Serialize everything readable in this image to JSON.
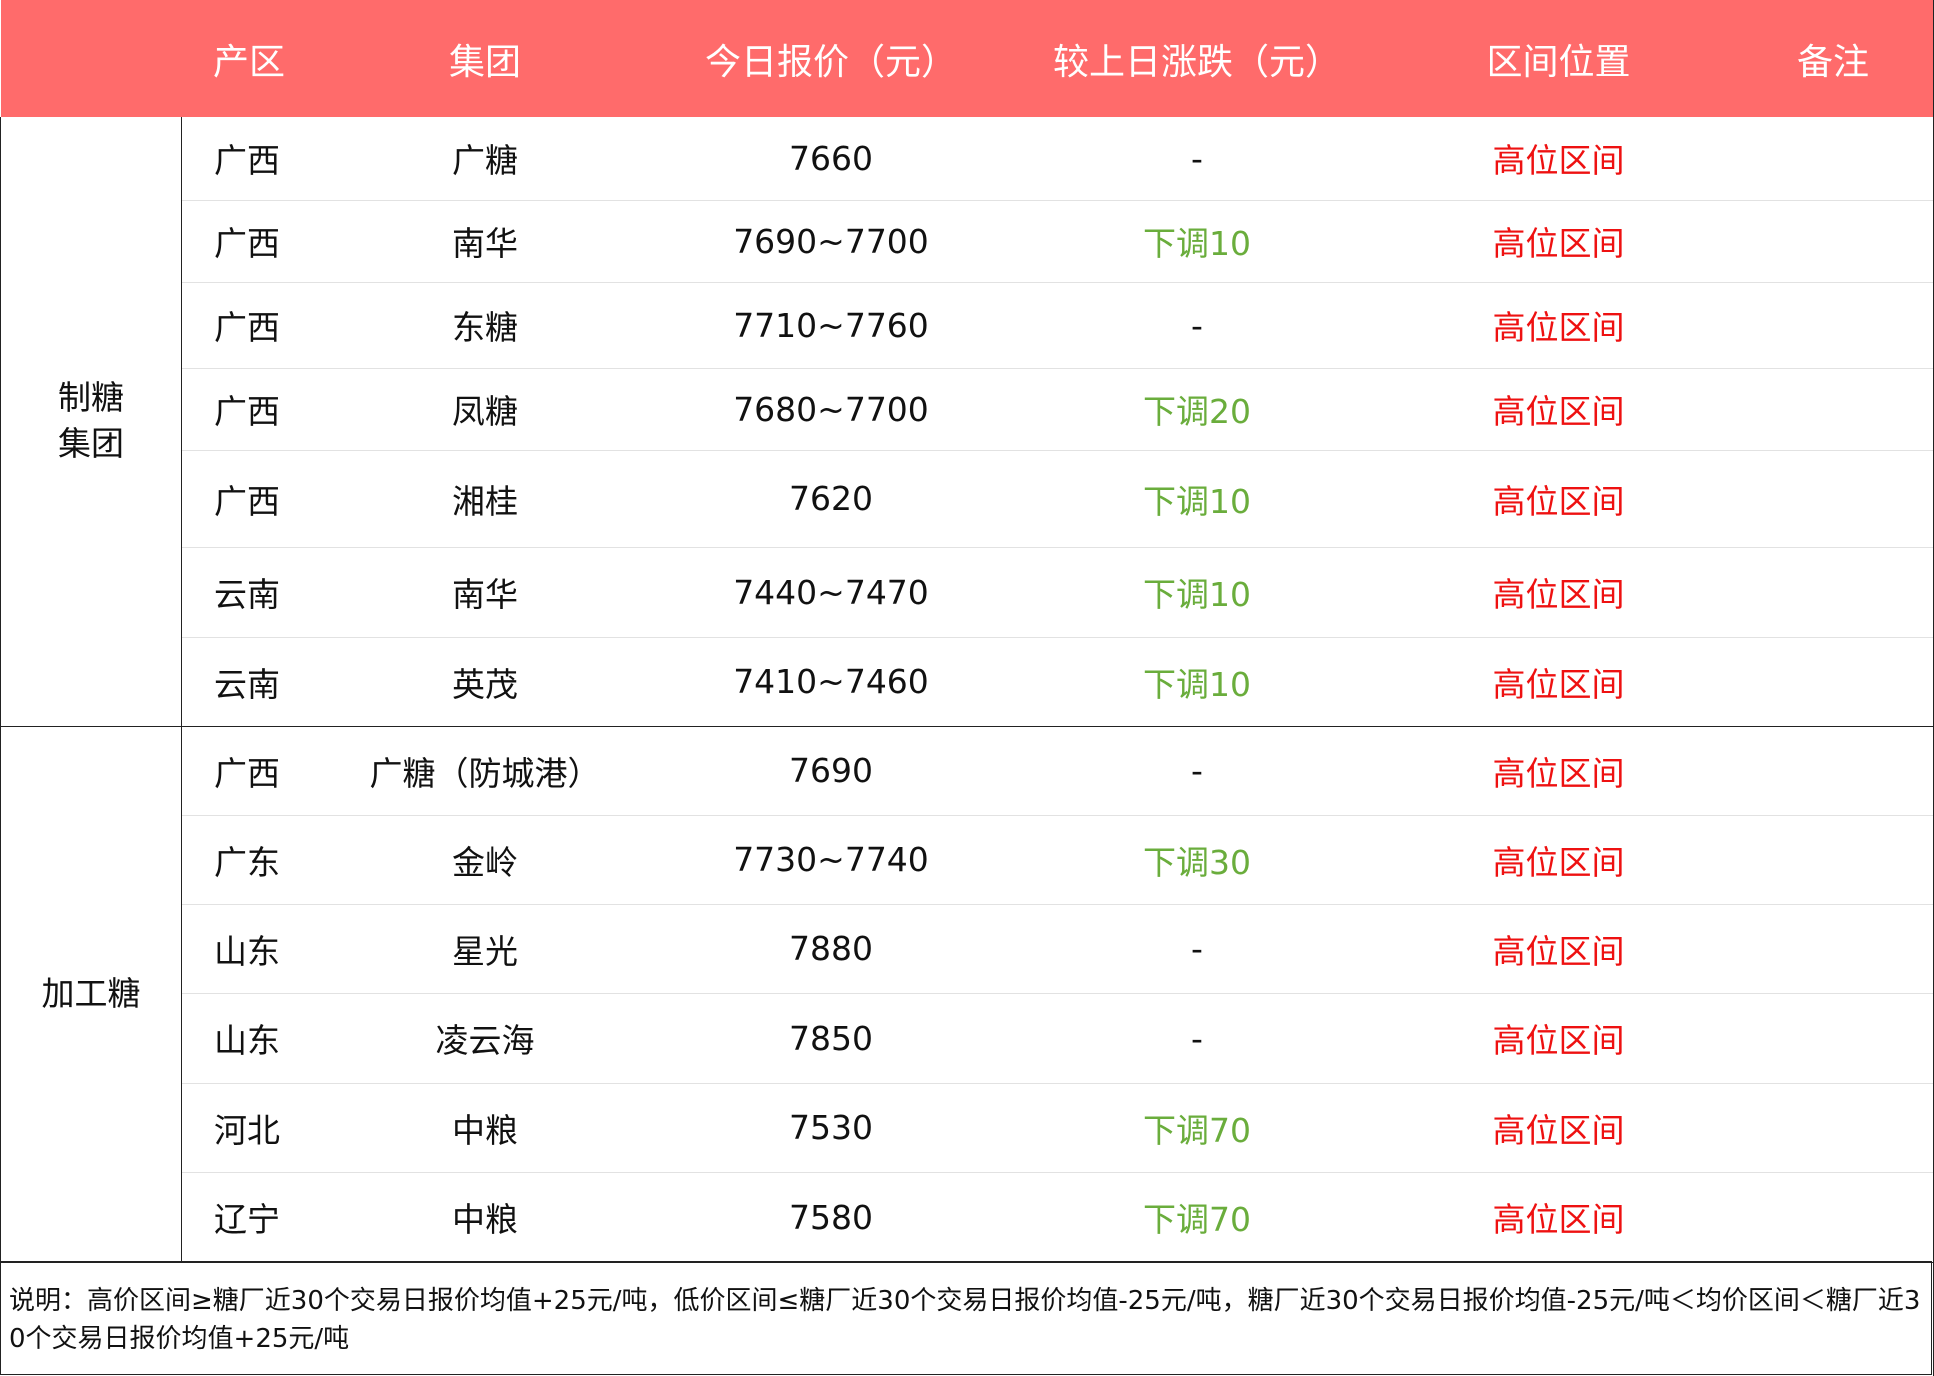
{
  "headers": {
    "group_col": "",
    "region": "产区",
    "company": "集团",
    "price": "今日报价（元）",
    "change": "较上日涨跌（元）",
    "position": "区间位置",
    "remark": "备注"
  },
  "groups": [
    {
      "label": "制糖集团",
      "label_line1": "制糖",
      "label_line2": "集团",
      "rows": [
        {
          "region": "广西",
          "company": "广糖",
          "price": "7660",
          "change": "-",
          "position": "高位区间",
          "remark": ""
        },
        {
          "region": "广西",
          "company": "南华",
          "price": "7690~7700",
          "change": "下调10",
          "position": "高位区间",
          "remark": ""
        },
        {
          "region": "广西",
          "company": "东糖",
          "price": "7710~7760",
          "change": "-",
          "position": "高位区间",
          "remark": ""
        },
        {
          "region": "广西",
          "company": "凤糖",
          "price": "7680~7700",
          "change": "下调20",
          "position": "高位区间",
          "remark": ""
        },
        {
          "region": "广西",
          "company": "湘桂",
          "price": "7620",
          "change": "下调10",
          "position": "高位区间",
          "remark": ""
        },
        {
          "region": "云南",
          "company": "南华",
          "price": "7440~7470",
          "change": "下调10",
          "position": "高位区间",
          "remark": ""
        },
        {
          "region": "云南",
          "company": "英茂",
          "price": "7410~7460",
          "change": "下调10",
          "position": "高位区间",
          "remark": ""
        }
      ]
    },
    {
      "label": "加工糖",
      "rows": [
        {
          "region": "广西",
          "company": "广糖（防城港）",
          "price": "7690",
          "change": "-",
          "position": "高位区间",
          "remark": ""
        },
        {
          "region": "广东",
          "company": "金岭",
          "price": "7730~7740",
          "change": "下调30",
          "position": "高位区间",
          "remark": ""
        },
        {
          "region": "山东",
          "company": "星光",
          "price": "7880",
          "change": "-",
          "position": "高位区间",
          "remark": ""
        },
        {
          "region": "山东",
          "company": "凌云海",
          "price": "7850",
          "change": "-",
          "position": "高位区间",
          "remark": ""
        },
        {
          "region": "河北",
          "company": "中粮",
          "price": "7530",
          "change": "下调70",
          "position": "高位区间",
          "remark": ""
        },
        {
          "region": "辽宁",
          "company": "中粮",
          "price": "7580",
          "change": "下调70",
          "position": "高位区间",
          "remark": ""
        }
      ]
    }
  ],
  "note": "说明：高价区间≥糖厂近30个交易日报价均值+25元/吨，低价区间≤糖厂近30个交易日报价均值-25元/吨，糖厂近30个交易日报价均值-25元/吨＜均价区间＜糖厂近30个交易日报价均值+25元/吨",
  "colors": {
    "header_bg": "#ff6b6b",
    "header_text": "#ffffff",
    "change_down": "#6aad3c",
    "position_text": "#ee1111"
  }
}
